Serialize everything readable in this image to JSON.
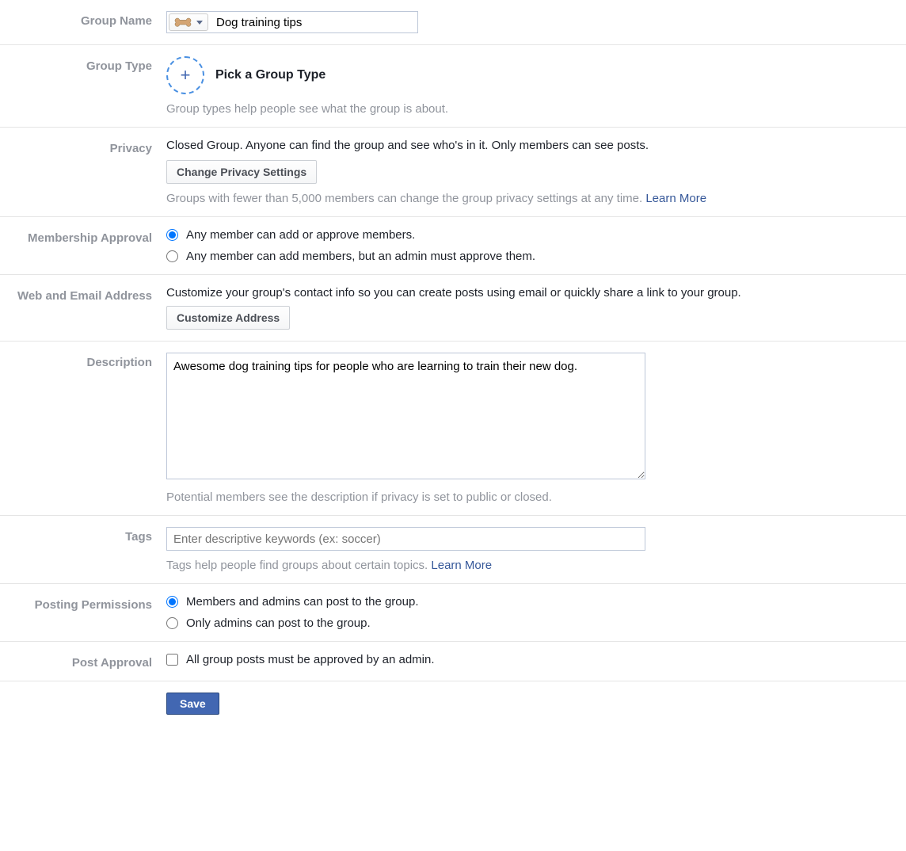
{
  "groupName": {
    "label": "Group Name",
    "value": "Dog training tips"
  },
  "groupType": {
    "label": "Group Type",
    "pickLabel": "Pick a Group Type",
    "helpText": "Group types help people see what the group is about."
  },
  "privacy": {
    "label": "Privacy",
    "description": "Closed Group. Anyone can find the group and see who's in it. Only members can see posts.",
    "buttonLabel": "Change Privacy Settings",
    "helpText": "Groups with fewer than 5,000 members can change the group privacy settings at any time. ",
    "learnMore": "Learn More"
  },
  "membershipApproval": {
    "label": "Membership Approval",
    "option1": "Any member can add or approve members.",
    "option2": "Any member can add members, but an admin must approve them."
  },
  "webAddress": {
    "label": "Web and Email Address",
    "description": "Customize your group's contact info so you can create posts using email or quickly share a link to your group.",
    "buttonLabel": "Customize Address"
  },
  "description": {
    "label": "Description",
    "value": "Awesome dog training tips for people who are learning to train their new dog.",
    "helpText": "Potential members see the description if privacy is set to public or closed."
  },
  "tags": {
    "label": "Tags",
    "placeholder": "Enter descriptive keywords (ex: soccer)",
    "helpText": "Tags help people find groups about certain topics. ",
    "learnMore": "Learn More"
  },
  "postingPermissions": {
    "label": "Posting Permissions",
    "option1": "Members and admins can post to the group.",
    "option2": "Only admins can post to the group."
  },
  "postApproval": {
    "label": "Post Approval",
    "checkboxLabel": "All group posts must be approved by an admin."
  },
  "saveButton": "Save"
}
